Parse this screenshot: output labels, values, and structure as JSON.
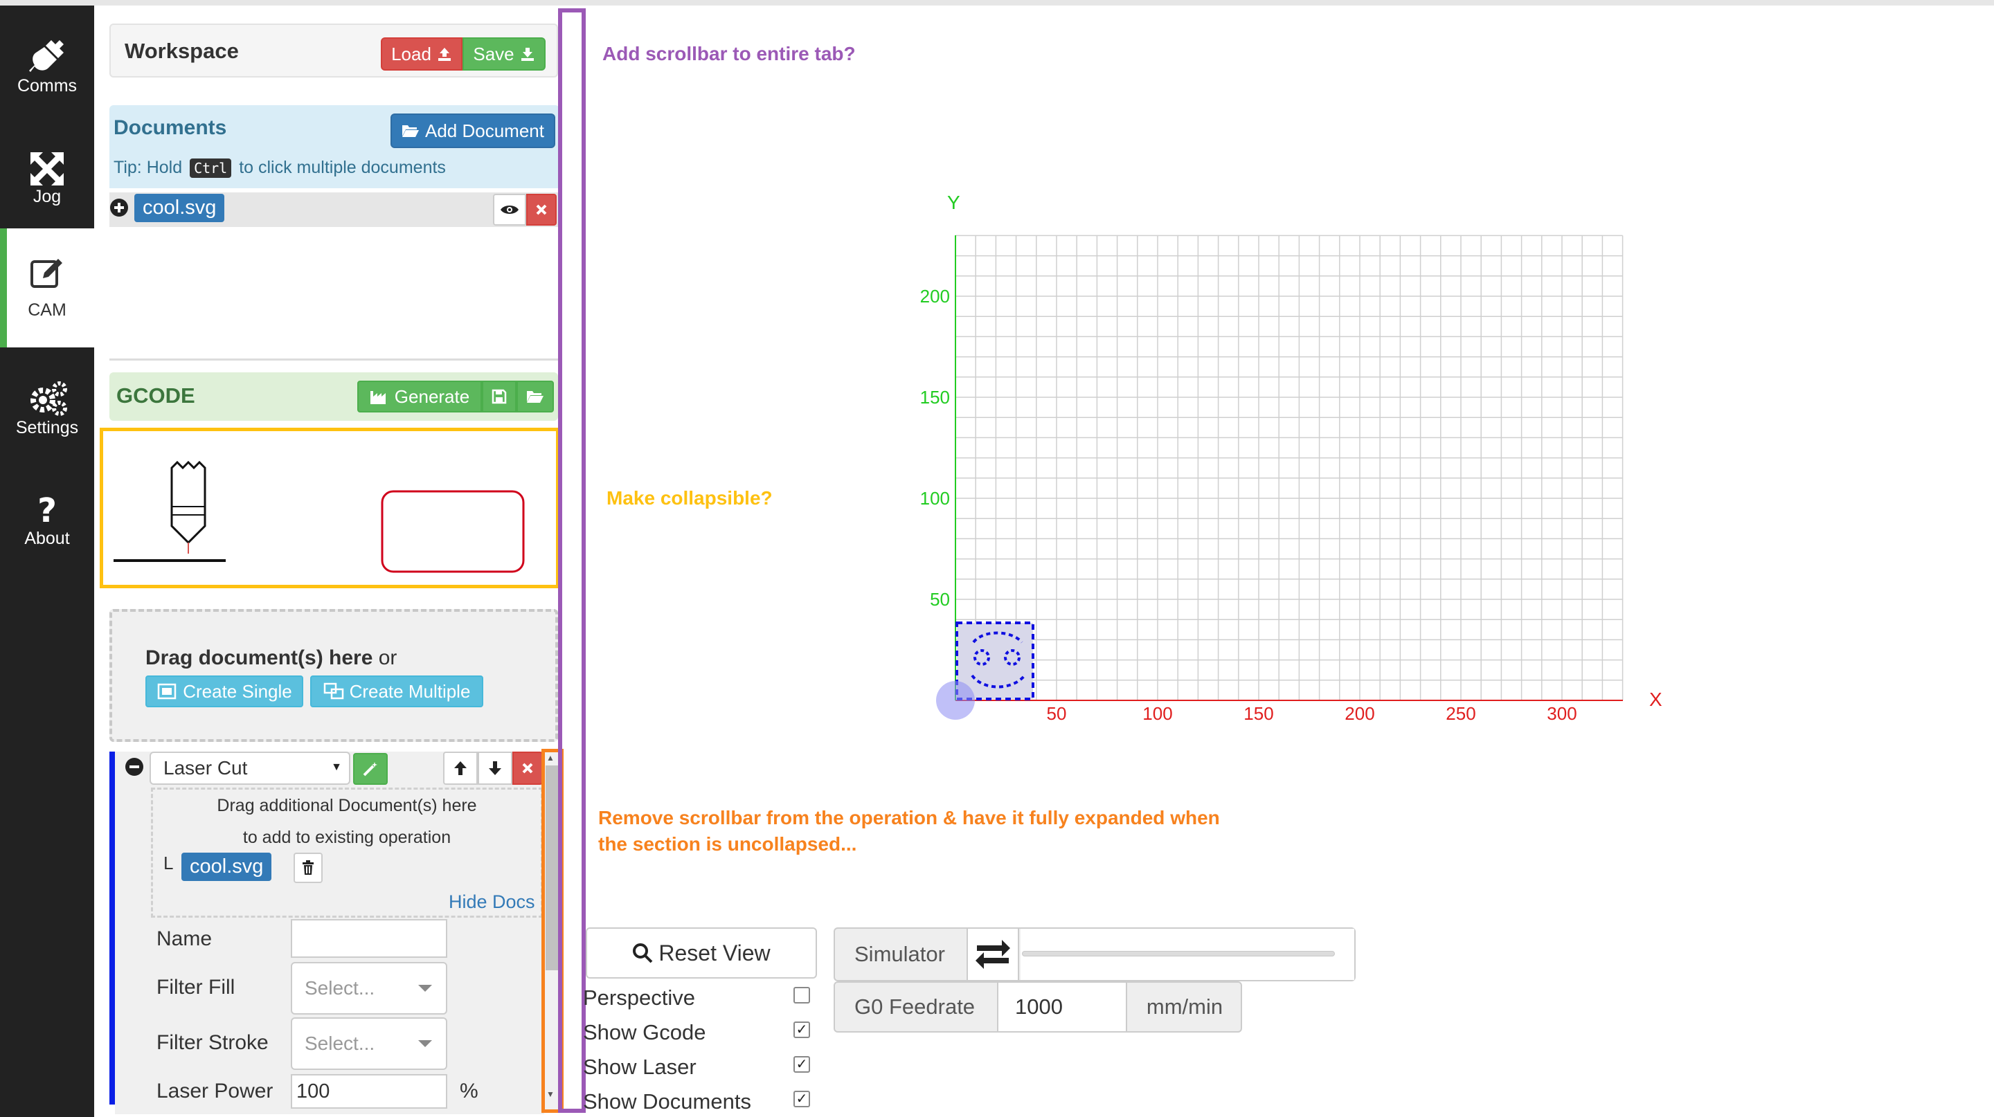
{
  "nav": {
    "items": [
      {
        "label": "Comms",
        "icon": "plug-icon"
      },
      {
        "label": "Jog",
        "icon": "move-arrows-icon"
      },
      {
        "label": "CAM",
        "icon": "edit-icon",
        "active": true
      },
      {
        "label": "Settings",
        "icon": "gears-icon"
      },
      {
        "label": "About",
        "icon": "question-icon"
      }
    ]
  },
  "workspace": {
    "title": "Workspace",
    "load_label": "Load",
    "save_label": "Save"
  },
  "documents": {
    "title": "Documents",
    "add_label": "Add Document",
    "tip_prefix": "Tip: Hold",
    "tip_key": "Ctrl",
    "tip_suffix": "to click multiple documents",
    "items": [
      {
        "name": "cool.svg"
      }
    ]
  },
  "gcode": {
    "title": "GCODE",
    "generate_label": "Generate"
  },
  "drop_zone": {
    "text_bold": "Drag document(s) here",
    "text_or": "or",
    "create_single": "Create Single",
    "create_multiple": "Create Multiple"
  },
  "operation": {
    "type_value": "Laser Cut",
    "add_docs_line1": "Drag additional Document(s) here",
    "add_docs_line2": "to add to existing operation",
    "doc_prefix": "L",
    "doc_name": "cool.svg",
    "hide_docs": "Hide Docs",
    "fields": {
      "name_label": "Name",
      "name_value": "",
      "filter_fill_label": "Filter Fill",
      "filter_fill_placeholder": "Select...",
      "filter_stroke_label": "Filter Stroke",
      "filter_stroke_placeholder": "Select...",
      "laser_power_label": "Laser Power",
      "laser_power_value": "100",
      "laser_power_unit": "%"
    }
  },
  "annotations": {
    "purple_note": "Add scrollbar to entire tab?",
    "yellow_note": "Make collapsible?",
    "orange_note_line1": "Remove scrollbar from the operation & have it fully expanded when",
    "orange_note_line2": "the section is uncollapsed...",
    "colors": {
      "purple": "#9b59b6",
      "yellow": "#fec111",
      "orange": "#f7821e"
    }
  },
  "canvas": {
    "x_axis_label": "X",
    "y_axis_label": "Y",
    "x_ticks": [
      "50",
      "100",
      "150",
      "200",
      "250",
      "300"
    ],
    "y_ticks": [
      "50",
      "100",
      "150",
      "200"
    ],
    "x_color": "#e01e1e",
    "y_color": "#22cc22"
  },
  "view_controls": {
    "reset_view": "Reset View",
    "perspective": {
      "label": "Perspective",
      "checked": false
    },
    "show_gcode": {
      "label": "Show Gcode",
      "checked": true
    },
    "show_laser": {
      "label": "Show Laser",
      "checked": true
    },
    "show_documents": {
      "label": "Show Documents",
      "checked": true
    },
    "simulator_label": "Simulator",
    "g0_label": "G0 Feedrate",
    "g0_value": "1000",
    "g0_unit": "mm/min"
  }
}
